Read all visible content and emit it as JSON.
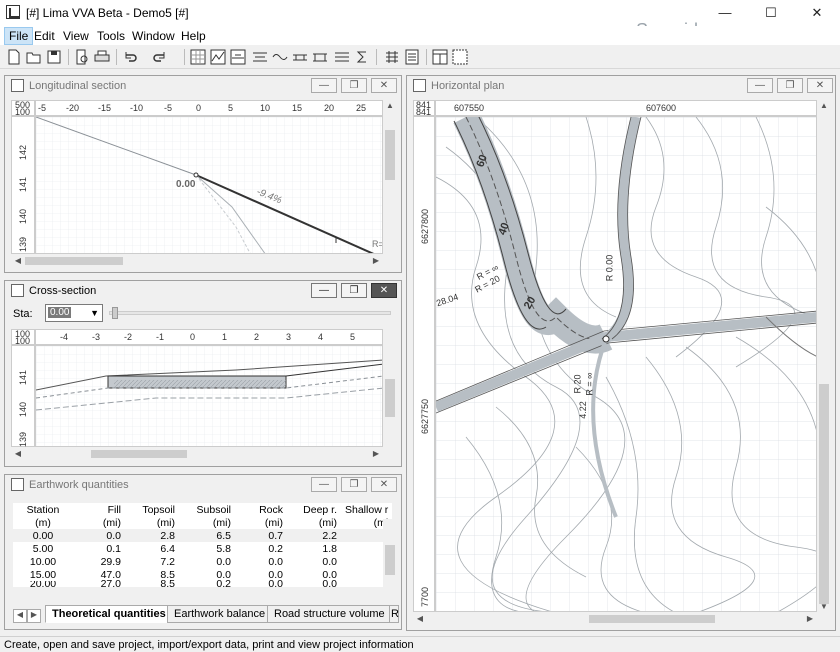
{
  "window": {
    "title": "[#] Lima VVA Beta - Demo5 [#]",
    "minimize": "—",
    "maximize": "☐",
    "close": "✕",
    "watermark": "Sonraid.ru"
  },
  "menu": {
    "items": [
      {
        "label": "File",
        "underline": "F"
      },
      {
        "label": "Edit",
        "underline": "E"
      },
      {
        "label": "View",
        "underline": "V"
      },
      {
        "label": "Tools",
        "underline": "T"
      },
      {
        "label": "Window",
        "underline": "W"
      },
      {
        "label": "Help",
        "underline": "H"
      }
    ]
  },
  "toolbar": {
    "icons": [
      "new-icon",
      "open-icon",
      "save-icon",
      "print-preview-icon",
      "print-icon",
      "undo-icon",
      "redo-icon",
      "grid-icon",
      "profile-icon",
      "section-icon",
      "layers-icon",
      "wave-icon",
      "road-icon",
      "bridge-icon",
      "culvert-icon",
      "sigma-icon",
      "network-icon",
      "list-icon",
      "layout-icon",
      "frame-icon"
    ]
  },
  "panels": {
    "longitudinal": {
      "title": "Longitudinal section",
      "ruler_scale_top": "500",
      "ruler_scale_bottom": "100",
      "x_ticks": [
        "-5",
        "-20",
        "-15",
        "-10",
        "-5",
        "0",
        "5",
        "10",
        "15",
        "20",
        "25"
      ],
      "y_ticks": [
        "142",
        "141",
        "140",
        "139"
      ],
      "label_elev": "0.00",
      "label_grade": "-9.4%",
      "label_r": "R="
    },
    "cross": {
      "title": "Cross-section",
      "sta_label": "Sta:",
      "sta_value": "0.00",
      "ruler_scale_top": "100",
      "ruler_scale_bottom": "100",
      "x_ticks": [
        "-4",
        "-3",
        "-2",
        "-1",
        "0",
        "1",
        "2",
        "3",
        "4",
        "5"
      ],
      "y_ticks": [
        "141",
        "140",
        "139"
      ]
    },
    "earthwork": {
      "title": "Earthwork quantities",
      "columns": [
        {
          "name": "Station",
          "unit": "(m)"
        },
        {
          "name": "Fill",
          "unit": "(mi)"
        },
        {
          "name": "Topsoil",
          "unit": "(mi)"
        },
        {
          "name": "Subsoil",
          "unit": "(mi)"
        },
        {
          "name": "Rock",
          "unit": "(mi)"
        },
        {
          "name": "Deep r.",
          "unit": "(mi)"
        },
        {
          "name": "Shallow r",
          "unit": "(mi"
        }
      ],
      "rows": [
        [
          "0.00",
          "0.0",
          "2.8",
          "6.5",
          "0.7",
          "2.2",
          ""
        ],
        [
          "5.00",
          "0.1",
          "6.4",
          "5.8",
          "0.2",
          "1.8",
          ""
        ],
        [
          "10.00",
          "29.9",
          "7.2",
          "0.0",
          "0.0",
          "0.0",
          ""
        ],
        [
          "15.00",
          "47.0",
          "8.5",
          "0.0",
          "0.0",
          "0.0",
          ""
        ],
        [
          "20.00",
          "27.0",
          "8.5",
          "0.2",
          "0.0",
          "0.0",
          ""
        ]
      ],
      "tabs": [
        "Theoretical quantities",
        "Earthwork balance",
        "Road structure volume",
        "R"
      ]
    },
    "horizontal": {
      "title": "Horizontal plan",
      "ruler_scale_top": "841",
      "ruler_scale_bottom": "841",
      "x_ticks": [
        "607550",
        "607600"
      ],
      "y_ticks": [
        "6627800",
        "6627750",
        "7700"
      ],
      "labels": [
        "60",
        "40",
        "20",
        "R = ∞",
        "R = 20",
        "28.04",
        "R 0.00",
        "R 20",
        "R = ∞",
        "4.22"
      ]
    }
  },
  "status": {
    "text": "Create, open and save project, import/export data, print and view project information"
  },
  "colors": {
    "grid": "#d9dde2",
    "road_fill": "#b7bec4",
    "contour": "#9aa0a6",
    "accent": "#cce4f7"
  }
}
